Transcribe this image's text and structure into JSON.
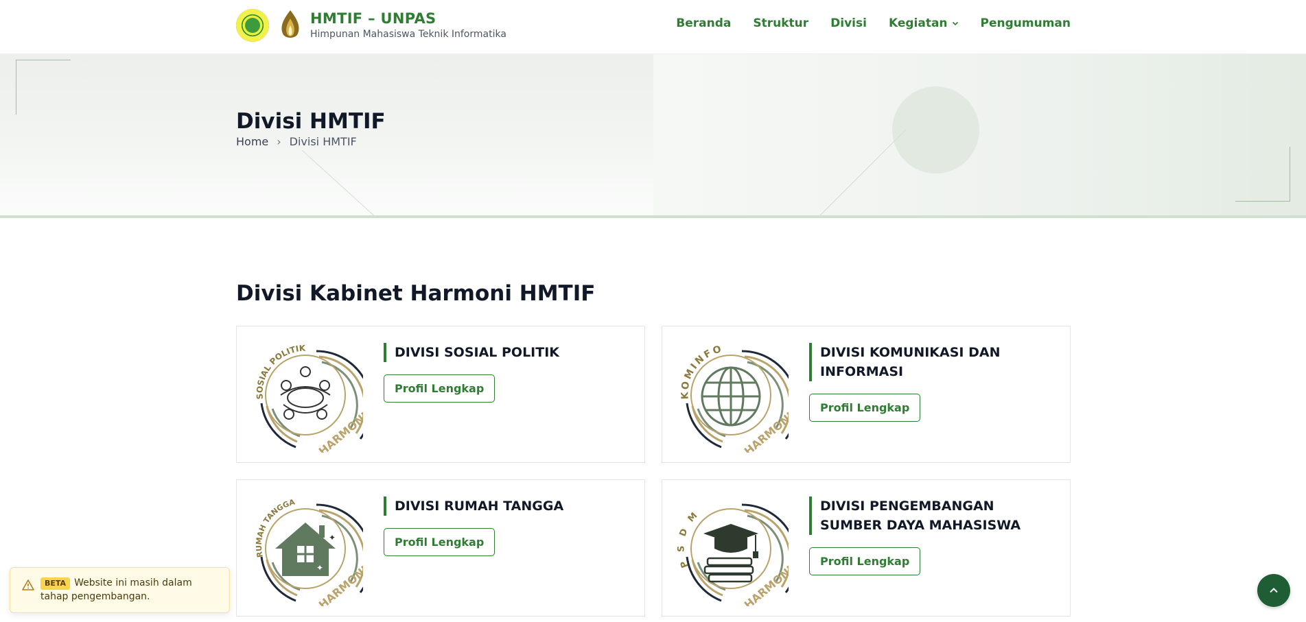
{
  "header": {
    "brand_title": "HMTIF – UNPAS",
    "brand_subtitle": "Himpunan Mahasiswa Teknik Informatika",
    "nav": [
      "Beranda",
      "Struktur",
      "Divisi",
      "Kegiatan",
      "Pengumuman"
    ]
  },
  "hero": {
    "title": "Divisi HMTIF",
    "breadcrumb": {
      "home": "Home",
      "separator": "›",
      "current": "Divisi HMTIF"
    }
  },
  "section": {
    "title": "Divisi Kabinet Harmoni HMTIF"
  },
  "cards": [
    {
      "title": "DIVISI SOSIAL POLITIK",
      "button": "Profil Lengkap",
      "icon": "people-around-table-icon",
      "logo_arc": "SOSIAL POLITIK",
      "logo_corner": "HARMONI"
    },
    {
      "title": "DIVISI KOMUNIKASI DAN INFORMASI",
      "button": "Profil Lengkap",
      "icon": "globe-icon",
      "logo_arc": "KOMINFO",
      "logo_corner": "HARMONI"
    },
    {
      "title": "DIVISI RUMAH TANGGA",
      "button": "Profil Lengkap",
      "icon": "house-icon",
      "logo_arc": "RUMAH TANGGA",
      "logo_corner": "HARMONI"
    },
    {
      "title": "DIVISI PENGEMBANGAN SUMBER DAYA MAHASISWA",
      "button": "Profil Lengkap",
      "icon": "graduation-cap-books-icon",
      "logo_arc": "P S D M",
      "logo_corner": "HARMONI"
    }
  ],
  "beta_notice": {
    "badge": "BETA",
    "text": "Website ini masih dalam tahap pengembangan."
  },
  "colors": {
    "primary": "#2e7d32",
    "dark": "#111827",
    "logo_olive": "#5f7a5f",
    "logo_gold": "#b9a36a",
    "scroll_btn": "#1f5e34"
  }
}
